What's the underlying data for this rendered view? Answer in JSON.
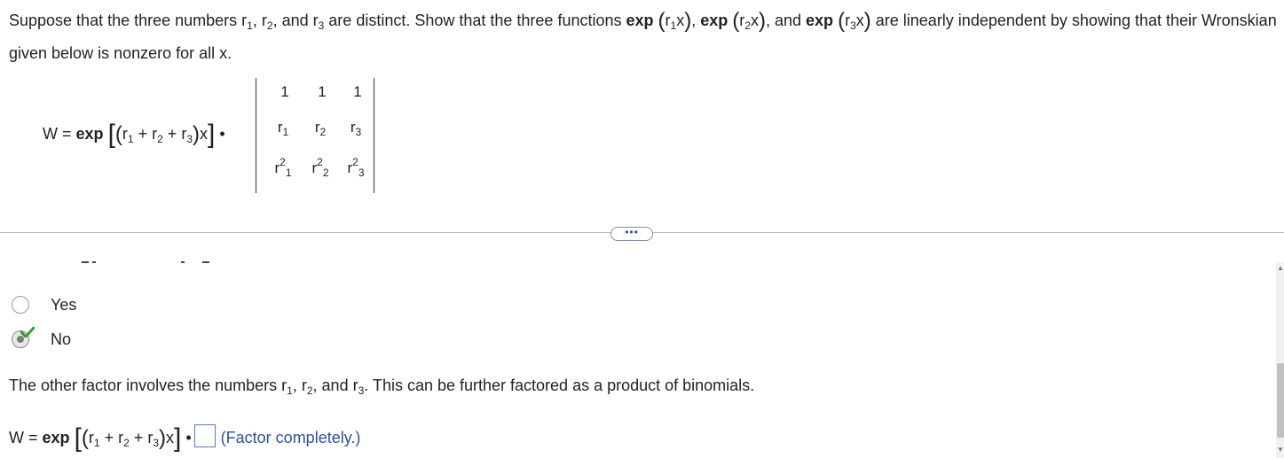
{
  "prompt": {
    "part1": "Suppose that the three numbers ",
    "r": "r",
    "sub1": "1",
    "sub2": "2",
    "sub3": "3",
    "comma": ", ",
    "and": ", and ",
    "part2": " are distinct. Show that the three functions ",
    "exp": "exp",
    "x": "x",
    "and2": ", and ",
    "part3": " are linearly independent by showing that their Wronskian given below is nonzero for all x."
  },
  "wronskian": {
    "lhs": "W = ",
    "exp": "exp",
    "plus": " + ",
    "x": "x",
    "dot": "•",
    "matrix": {
      "row1": [
        "1",
        "1",
        "1"
      ],
      "row2": [
        "r",
        "r",
        "r"
      ],
      "row2_subs": [
        "1",
        "2",
        "3"
      ],
      "row3_base": [
        "r",
        "r",
        "r"
      ],
      "row3_sup": [
        "2",
        "2",
        "2"
      ],
      "row3_subs": [
        "1",
        "2",
        "3"
      ]
    }
  },
  "ellipsis_label": "•••",
  "options": [
    {
      "label": "Yes",
      "selected": false
    },
    {
      "label": "No",
      "selected": true,
      "marked_correct": true
    }
  ],
  "factor": {
    "text_before": "The other factor involves the numbers ",
    "text_after": ". This can be further factored as a product of binomials."
  },
  "answer_row": {
    "lhs": "W = ",
    "hint": "(Factor completely.)",
    "value": ""
  },
  "colors": {
    "check_green": "#2e9e2e",
    "hint_blue": "#2f4f9f",
    "box_border": "#5a7bbf"
  }
}
